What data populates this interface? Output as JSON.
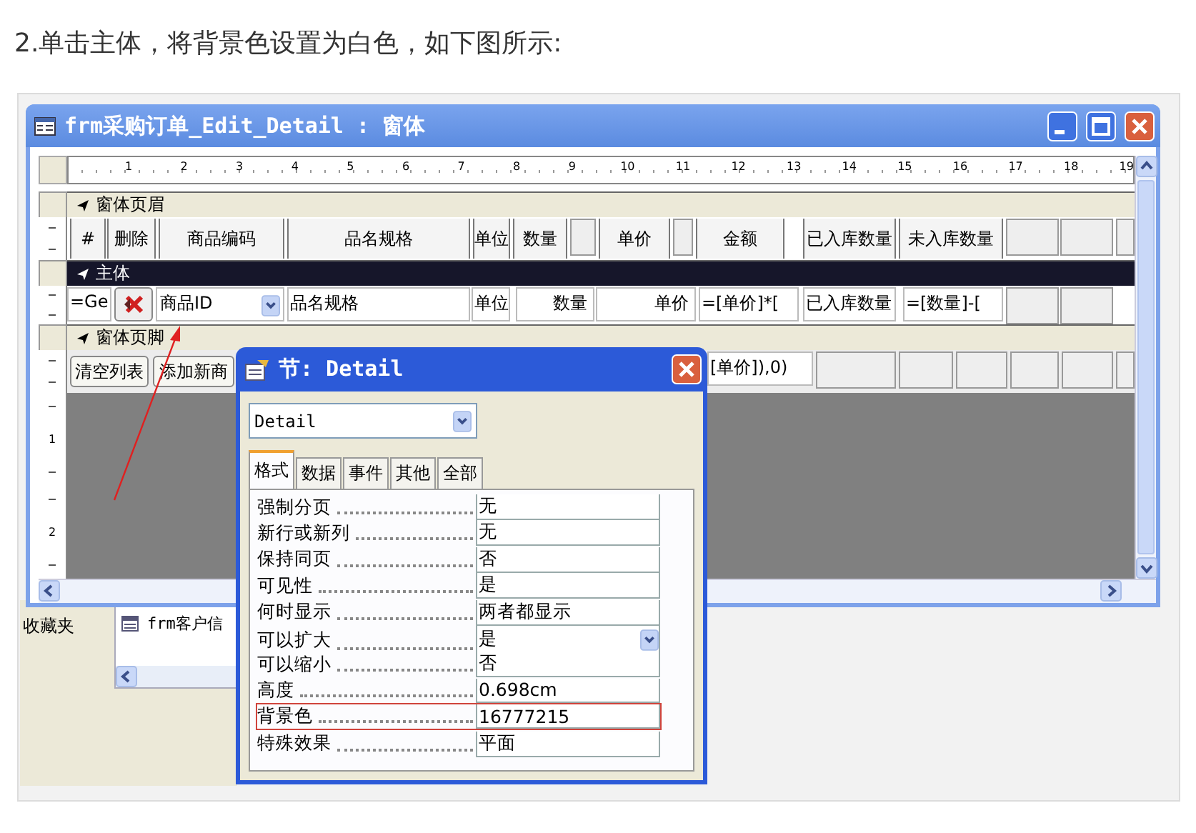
{
  "caption": "2.单击主体，将背景色设置为白色，如下图所示:",
  "back_window": {
    "side_label": "收藏夹",
    "item": "frm客户信"
  },
  "form_window": {
    "title": "frm采购订单_Edit_Detail : 窗体",
    "ruler": [
      "1",
      "2",
      "3",
      "4",
      "5",
      "6",
      "7",
      "8",
      "9",
      "10",
      "11",
      "12",
      "13",
      "14",
      "15",
      "16",
      "17",
      "18",
      "19"
    ],
    "side_ruler": [
      "1",
      "2"
    ],
    "sections": [
      {
        "title": "窗体页眉",
        "selected": false,
        "controls": [
          {
            "kind": "label",
            "text": "#"
          },
          {
            "kind": "label",
            "text": "删除"
          },
          {
            "kind": "label",
            "text": "商品编码"
          },
          {
            "kind": "label",
            "text": "品名规格"
          },
          {
            "kind": "label",
            "text": "单位"
          },
          {
            "kind": "label",
            "text": "数量"
          },
          {
            "kind": "empty"
          },
          {
            "kind": "label",
            "text": "单价"
          },
          {
            "kind": "empty"
          },
          {
            "kind": "label",
            "text": "金额"
          },
          {
            "kind": "label",
            "text": "已入库数量"
          },
          {
            "kind": "label",
            "text": "未入库数量"
          },
          {
            "kind": "empty"
          },
          {
            "kind": "empty"
          },
          {
            "kind": "empty"
          }
        ]
      },
      {
        "title": "主体",
        "selected": true,
        "controls": [
          {
            "kind": "text",
            "text": "=Ge"
          },
          {
            "kind": "icon_button"
          },
          {
            "kind": "combo",
            "text": "商品ID"
          },
          {
            "kind": "text",
            "text": "品名规格"
          },
          {
            "kind": "text",
            "text": "单位"
          },
          {
            "kind": "number",
            "text": "数量"
          },
          {
            "kind": "number",
            "text": "单价"
          },
          {
            "kind": "text",
            "text": "=[单价]*["
          },
          {
            "kind": "text",
            "text": "已入库数量"
          },
          {
            "kind": "text",
            "text": "=[数量]-["
          },
          {
            "kind": "empty"
          },
          {
            "kind": "empty"
          }
        ]
      },
      {
        "title": "窗体页脚",
        "selected": false,
        "controls": [
          {
            "kind": "button",
            "text": "清空列表"
          },
          {
            "kind": "button",
            "text": "添加新商"
          },
          {
            "kind": "text",
            "text": "[单价]),0)"
          },
          {
            "kind": "empty"
          },
          {
            "kind": "empty"
          },
          {
            "kind": "empty"
          },
          {
            "kind": "empty"
          },
          {
            "kind": "empty"
          },
          {
            "kind": "empty"
          }
        ]
      }
    ]
  },
  "property_sheet": {
    "title": "节: Detail",
    "object": "Detail",
    "tabs": [
      {
        "label": "格式",
        "selected": true
      },
      {
        "label": "数据",
        "selected": false
      },
      {
        "label": "事件",
        "selected": false
      },
      {
        "label": "其他",
        "selected": false
      },
      {
        "label": "全部",
        "selected": false
      }
    ],
    "properties": [
      {
        "name": "强制分页",
        "value": "无",
        "highlighted": false,
        "dropdown": false
      },
      {
        "name": "新行或新列",
        "value": "无",
        "highlighted": false,
        "dropdown": false
      },
      {
        "name": "保持同页",
        "value": "否",
        "highlighted": false,
        "dropdown": false
      },
      {
        "name": "可见性",
        "value": "是",
        "highlighted": false,
        "dropdown": false
      },
      {
        "name": "何时显示",
        "value": "两者都显示",
        "highlighted": false,
        "dropdown": false
      },
      {
        "name": "可以扩大",
        "value": "是",
        "highlighted": false,
        "dropdown": true
      },
      {
        "name": "可以缩小",
        "value": "否",
        "highlighted": false,
        "dropdown": false
      },
      {
        "name": "高度",
        "value": "0.698cm",
        "highlighted": false,
        "dropdown": false
      },
      {
        "name": "背景色",
        "value": "16777215",
        "highlighted": true,
        "dropdown": false
      },
      {
        "name": "特殊效果",
        "value": "平面",
        "highlighted": false,
        "dropdown": false
      }
    ]
  }
}
